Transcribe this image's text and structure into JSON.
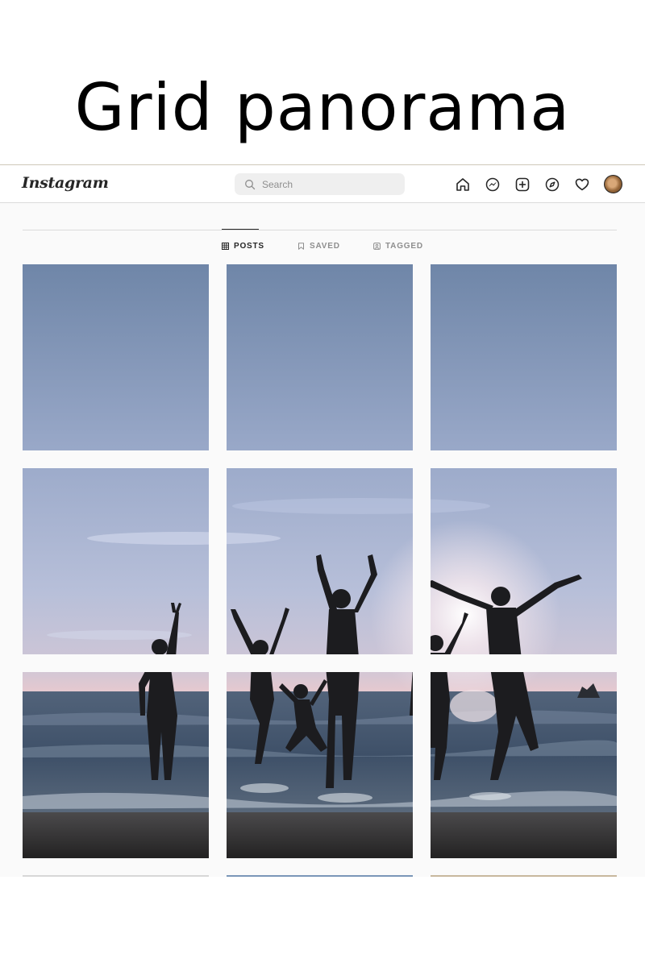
{
  "banner": {
    "title": "Grid panorama"
  },
  "header": {
    "logo": "Instagram",
    "search": {
      "placeholder": "Search"
    },
    "nav_icons": [
      "home-icon",
      "messenger-icon",
      "new-post-icon",
      "explore-icon",
      "activity-icon",
      "profile-avatar"
    ]
  },
  "tabs": [
    {
      "label": "POSTS",
      "icon": "grid-icon",
      "active": true
    },
    {
      "label": "SAVED",
      "icon": "bookmark-icon",
      "active": false
    },
    {
      "label": "TAGGED",
      "icon": "tagged-icon",
      "active": false
    }
  ],
  "grid": {
    "rows": 3,
    "columns": 3,
    "image": "beach-silhouettes-panorama",
    "palette": {
      "sky_top": "#6f86a8",
      "sky_mid": "#aab6d2",
      "horizon_glow": "#e6c9cf",
      "sea": "#45586e",
      "sand": "#2a2a2a",
      "silhouette": "#1c1c1f"
    }
  }
}
